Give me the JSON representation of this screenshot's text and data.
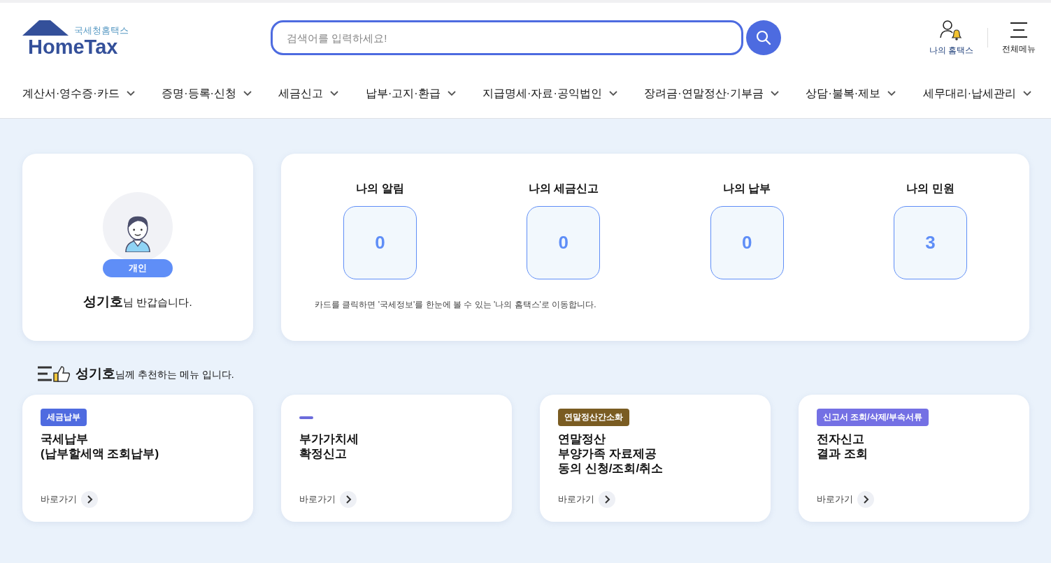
{
  "header": {
    "logo": {
      "subtitle": "국세청홈택스",
      "title": "HomeTax"
    },
    "search": {
      "placeholder": "검색어를 입력하세요!"
    },
    "utilities": [
      {
        "kind": "my",
        "label": "나의 홈택스"
      },
      {
        "kind": "menu",
        "label": "전체메뉴"
      }
    ]
  },
  "nav": [
    {
      "label": "계산서·영수증·카드"
    },
    {
      "label": "증명·등록·신청"
    },
    {
      "label": "세금신고"
    },
    {
      "label": "납부·고지·환급"
    },
    {
      "label": "지급명세·자료·공익법인"
    },
    {
      "label": "장려금·연말정산·기부금"
    },
    {
      "label": "상담·불복·제보"
    },
    {
      "label": "세무대리·납세관리"
    }
  ],
  "profile": {
    "badge": "개인",
    "greeting": "**성기호**님 반갑습니다."
  },
  "summary": {
    "items": [
      {
        "title": "나의 알림",
        "count": "0"
      },
      {
        "title": "나의 세금신고",
        "count": "0"
      },
      {
        "title": "나의 납부",
        "count": "0"
      },
      {
        "title": "나의 민원",
        "count": "3"
      }
    ],
    "note": "카드를 클릭하면 '국세정보'를 한눈에 볼 수 있는 '나의 홈택스'로 이동합니다."
  },
  "recommend": {
    "heading": "**성기호**님께 추천하는 메뉴 입니다.",
    "cards": [
      {
        "tag": {
          "kind": "label",
          "label": "세금납부",
          "color": "#4f6be0"
        },
        "title": "국세납부\n(납부할세액 조회납부)",
        "link": "바로가기"
      },
      {
        "tag": {
          "kind": "dash",
          "color": "#6b6bdb"
        },
        "title": "부가가치세\n확정신고",
        "link": "바로가기"
      },
      {
        "tag": {
          "kind": "label",
          "label": "연말정산간소화",
          "color": "#7a5c22"
        },
        "title": "연말정산\n부양가족 자료제공\n동의 신청/조회/취소",
        "link": "바로가기"
      },
      {
        "tag": {
          "kind": "label",
          "label": "신고서 조회/삭제/부속서류",
          "color": "#7470e4"
        },
        "title": "전자신고\n결과 조회",
        "link": "바로가기"
      }
    ]
  }
}
